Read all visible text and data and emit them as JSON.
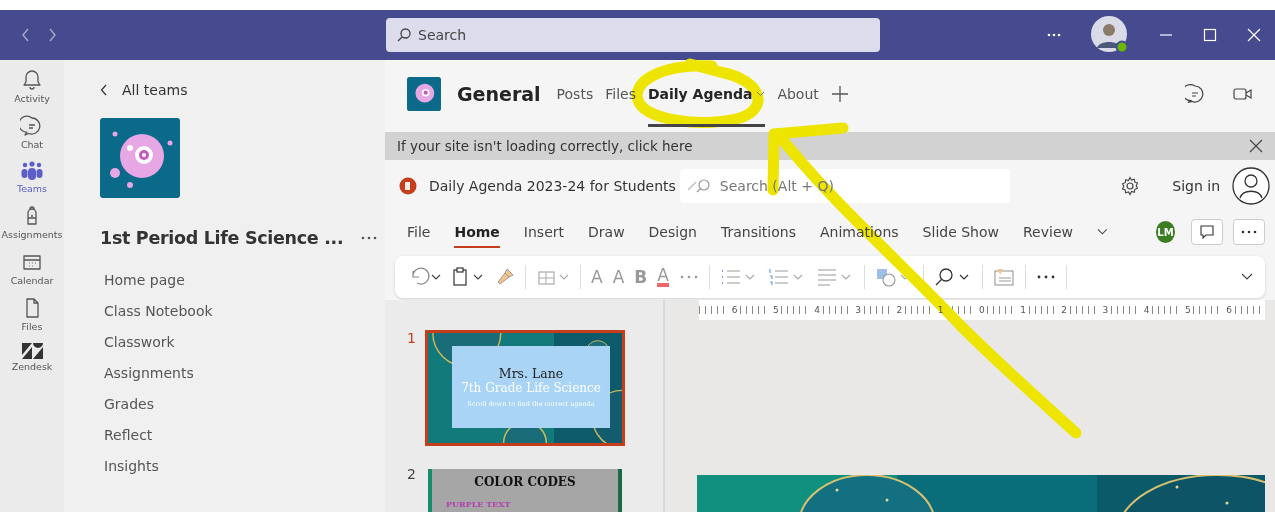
{
  "title_bar": {
    "search_placeholder": "Search"
  },
  "rail": [
    {
      "label": "Activity",
      "selected": false
    },
    {
      "label": "Chat",
      "selected": false
    },
    {
      "label": "Teams",
      "selected": true
    },
    {
      "label": "Assignments",
      "selected": false
    },
    {
      "label": "Calendar",
      "selected": false
    },
    {
      "label": "Files",
      "selected": false
    },
    {
      "label": "Zendesk",
      "selected": false
    }
  ],
  "team": {
    "back_link": "All teams",
    "name": "1st Period Life Science ...",
    "channels": [
      "Home page",
      "Class Notebook",
      "Classwork",
      "Assignments",
      "Grades",
      "Reflect",
      "Insights"
    ]
  },
  "channel": {
    "name": "General",
    "tabs": [
      {
        "label": "Posts",
        "selected": false,
        "dropdown": false
      },
      {
        "label": "Files",
        "selected": false,
        "dropdown": false
      },
      {
        "label": "Daily Agenda",
        "selected": true,
        "dropdown": true
      },
      {
        "label": "About",
        "selected": false,
        "dropdown": false
      }
    ]
  },
  "banner": {
    "text": "If your site isn't loading correctly, click here"
  },
  "ppt": {
    "file_name": "Daily Agenda 2023-24 for Students",
    "search_placeholder": "Search (Alt + Q)",
    "sign_in": "Sign in",
    "user_initials": "LM",
    "ribbon_tabs": [
      {
        "label": "File",
        "selected": false
      },
      {
        "label": "Home",
        "selected": true
      },
      {
        "label": "Insert",
        "selected": false
      },
      {
        "label": "Draw",
        "selected": false
      },
      {
        "label": "Design",
        "selected": false
      },
      {
        "label": "Transitions",
        "selected": false
      },
      {
        "label": "Animations",
        "selected": false
      },
      {
        "label": "Slide Show",
        "selected": false
      },
      {
        "label": "Review",
        "selected": false
      }
    ],
    "font_buttons": [
      {
        "text": "A"
      },
      {
        "text": "A"
      },
      {
        "text": "B"
      },
      {
        "text": "A"
      }
    ],
    "ruler_labels": [
      "6",
      "5",
      "4",
      "3",
      "2",
      "1",
      "0",
      "1",
      "2",
      "3",
      "4",
      "5",
      "6"
    ]
  },
  "slides": [
    {
      "kind": "title",
      "number": "1",
      "selected": true,
      "title": "Mrs. Lane",
      "subtitle": "7th Grade Life Science",
      "note": "Scroll down to find the correct agenda"
    },
    {
      "kind": "list",
      "number": "2",
      "selected": false,
      "title": "COLOR CODES",
      "line": "PURPLE TEXT"
    }
  ],
  "annotation": {
    "kind": "circle-arrow"
  }
}
